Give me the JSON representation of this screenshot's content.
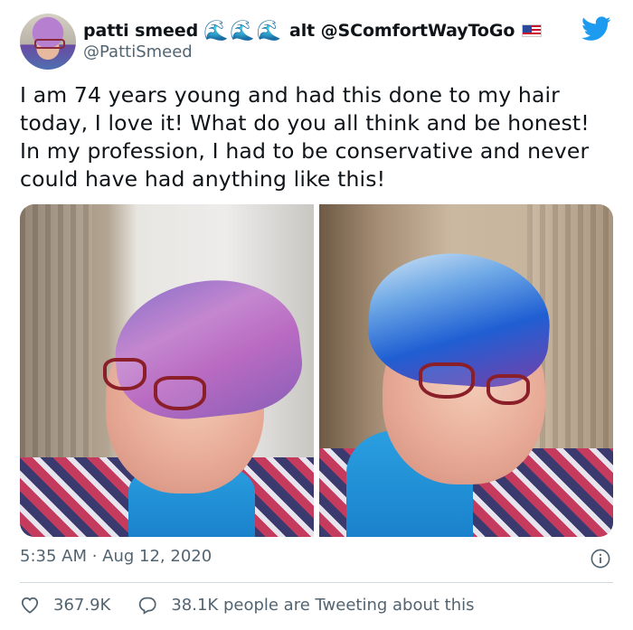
{
  "user": {
    "name": "patti smeed",
    "wave_emoji": "🌊",
    "alt_text": "alt @SComfortWayToGo",
    "flag": "us-flag",
    "handle": "@PattiSmeed",
    "avatar_icon": "avatar"
  },
  "tweet": {
    "text": "I am 74 years young and had this done to my hair\ntoday, I love it!  What do you all think and be honest!\nIn my profession, I had to be conservative and never\ncould have had anything like this!",
    "timestamp": "5:35 AM · Aug 12, 2020"
  },
  "media": {
    "photos": [
      "purple-hair-photo",
      "blue-hair-photo"
    ]
  },
  "engagement": {
    "likes": "367.9K",
    "tweeting_text": "38.1K people are Tweeting about this"
  },
  "icons": {
    "twitter": "twitter-bird-icon",
    "info": "info-icon",
    "heart": "heart-icon",
    "reply": "reply-icon"
  },
  "colors": {
    "accent": "#1d9bf0",
    "text": "#0f1419",
    "secondary": "#536471"
  }
}
